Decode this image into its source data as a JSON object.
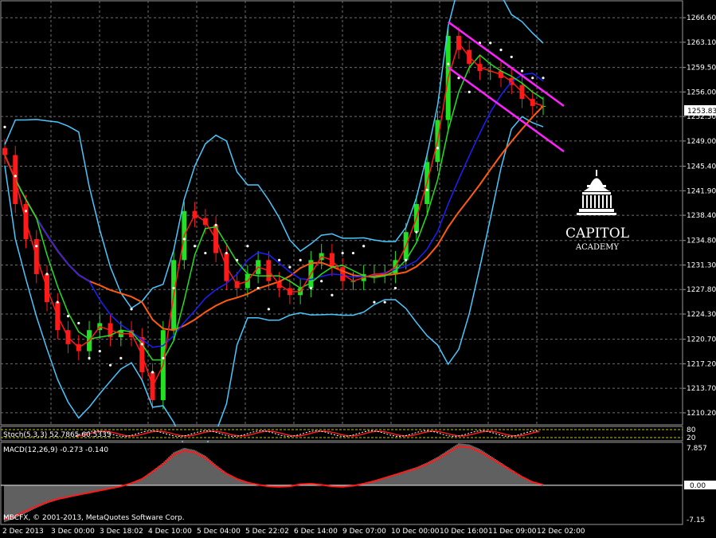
{
  "chart_data": {
    "type": "line",
    "symbol_note": "price chart with indicators",
    "ylim": [
      1208.6,
      1268.9
    ],
    "y_ticks": [
      "1266.60",
      "1263.10",
      "1259.50",
      "1256.00",
      "1252.50",
      "1249.00",
      "1245.40",
      "1241.90",
      "1238.40",
      "1234.80",
      "1231.30",
      "1227.80",
      "1224.30",
      "1220.70",
      "1217.20",
      "1213.70",
      "1210.20"
    ],
    "current_price": "1253.83",
    "x_labels": [
      "2 Dec 2013",
      "3 Dec 00:00",
      "3 Dec 18:02",
      "4 Dec 10:00",
      "5 Dec 04:00",
      "5 Dec 22:02",
      "6 Dec 14:00",
      "9 Dec 07:00",
      "10 Dec 00:00",
      "10 Dec 16:00",
      "11 Dec 09:00",
      "12 Dec 02:00"
    ],
    "close_series": [
      1247,
      1240,
      1235,
      1230,
      1226,
      1222,
      1220,
      1219,
      1222,
      1223,
      1221,
      1222,
      1221,
      1216,
      1212,
      1222,
      1232,
      1239,
      1238,
      1237,
      1233,
      1229,
      1228,
      1230,
      1232,
      1229,
      1228,
      1227,
      1228,
      1232,
      1233,
      1231,
      1229,
      1229,
      1230,
      1230,
      1230,
      1232,
      1236,
      1240,
      1246,
      1252,
      1264,
      1262,
      1260,
      1259,
      1259,
      1258,
      1257,
      1255,
      1254,
      1254
    ],
    "colors": {
      "bollinger": "#48c8ff",
      "ma_fast": "#ff1a1a",
      "ma_mid": "#22e022",
      "ma_slow": "#1e1eff",
      "ma_long": "#ff5a10",
      "channel": "#ff22ff",
      "sar": "#ffffff",
      "up_candle": "#22e022",
      "down_candle": "#ff1a1a"
    }
  },
  "stoch": {
    "label": "Stoch(5,3,3) 52.7865 60.5333",
    "levels": [
      "80",
      "20"
    ]
  },
  "macd": {
    "label": "MACD(12,26,9) -0.273 -0.140",
    "ticks": [
      "7.857",
      "0.00",
      "-7.15"
    ],
    "ylim": [
      -7.15,
      7.857
    ],
    "signal": [
      -6.5,
      -5.8,
      -4.9,
      -4,
      -3.2,
      -2.6,
      -2.2,
      -1.8,
      -1.4,
      -1,
      -0.6,
      -0.2,
      0.4,
      1.2,
      2.6,
      4,
      5.8,
      6.6,
      6.2,
      5.2,
      3.6,
      2.2,
      1.2,
      0.5,
      0.1,
      -0.2,
      -0.3,
      -0.2,
      0.2,
      0.3,
      0.1,
      -0.2,
      -0.3,
      -0.1,
      0.3,
      0.8,
      1.4,
      2,
      2.6,
      3.2,
      4,
      5,
      6.2,
      7.4,
      7.2,
      6.4,
      5.2,
      4,
      2.8,
      1.6,
      0.6,
      0.1
    ],
    "copyright": "MBCFX, © 2001-2013, MetaQuotes Software Corp."
  },
  "logo": {
    "line1": "CAPITOL",
    "line2": "ACADEMY"
  }
}
